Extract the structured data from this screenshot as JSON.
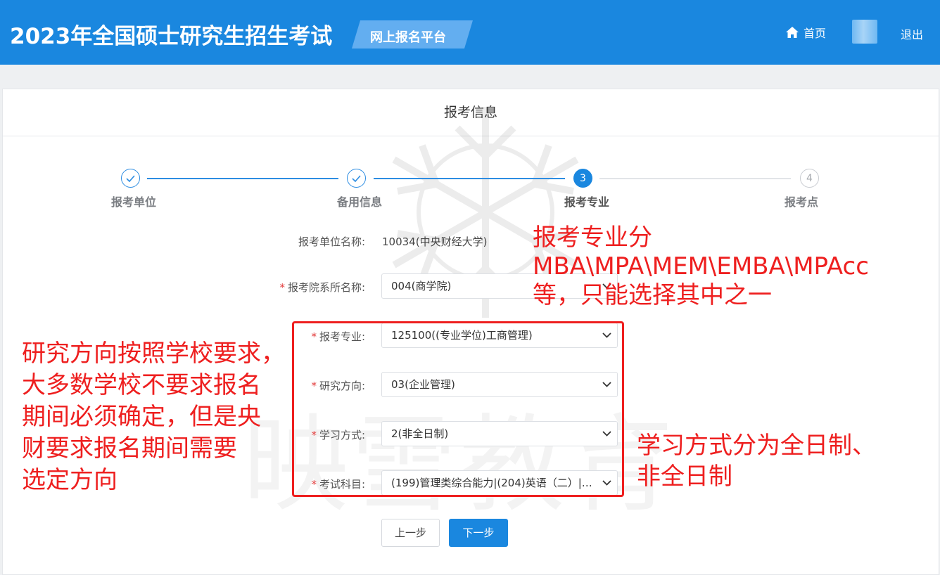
{
  "header": {
    "app_title": "2023年全国硕士研究生招生考试",
    "platform_badge": "网上报名平台",
    "home_label": "首页",
    "logout_label": "退出"
  },
  "card": {
    "title": "报考信息"
  },
  "steps": [
    {
      "number": "1",
      "label": "报考单位",
      "state": "done"
    },
    {
      "number": "2",
      "label": "备用信息",
      "state": "done"
    },
    {
      "number": "3",
      "label": "报考专业",
      "state": "active"
    },
    {
      "number": "4",
      "label": "报考点",
      "state": "todo"
    }
  ],
  "form": {
    "unit": {
      "label": "报考单位名称:",
      "value": "10034(中央财经大学)"
    },
    "department": {
      "label": "报考院系所名称:",
      "value": "004(商学院)"
    },
    "major": {
      "label": "报考专业:",
      "value": "125100((专业学位)工商管理)"
    },
    "direction": {
      "label": "研究方向:",
      "value": "03(企业管理)"
    },
    "study_mode": {
      "label": "学习方式:",
      "value": "2(非全日制)"
    },
    "subjects": {
      "label": "考试科目:",
      "value": "(199)管理类综合能力|(204)英语（二）|(..."
    },
    "required_mark": "*"
  },
  "buttons": {
    "prev": "上一步",
    "next": "下一步"
  },
  "watermark": {
    "text": "映雪教育"
  },
  "annotations": {
    "top": [
      "报考专业分",
      "MBA\\MPA\\MEM\\EMBA\\MPAcc",
      "等，只能选择其中之一"
    ],
    "left": [
      "研究方向按照学校要求，",
      "大多数学校不要求报名",
      "期间必须确定，但是央",
      "财要求报名期间需要",
      "选定方向"
    ],
    "right": [
      "学习方式分为全日制、",
      "非全日制"
    ]
  },
  "colors": {
    "header_bg": "#1a87df",
    "accent": "#1a87df",
    "annotation_red": "#ee1f1f",
    "required_red": "#e23a3a"
  },
  "icons": {
    "home": "home-icon",
    "check": "check-icon",
    "chevron": "chevron-down-icon"
  }
}
